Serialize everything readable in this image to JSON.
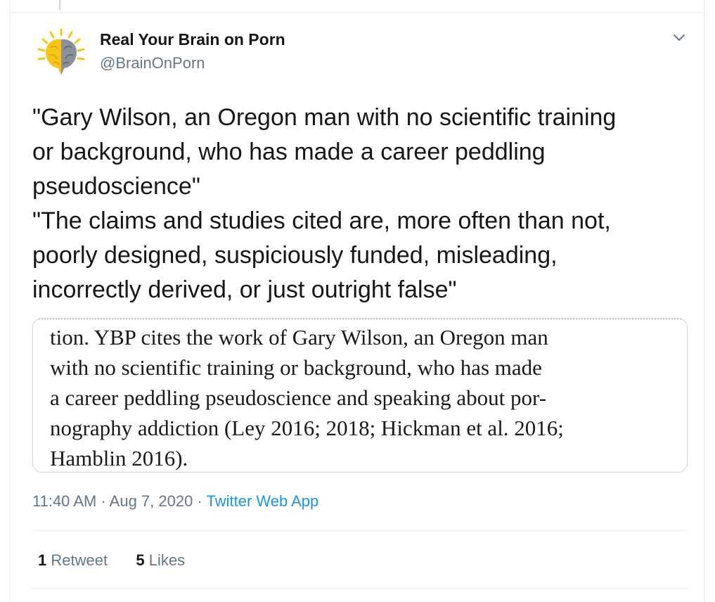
{
  "author": {
    "display_name": "Real Your Brain on Porn",
    "handle": "@BrainOnPorn",
    "avatar_icon": "brain-sun-logo-icon"
  },
  "tweet": {
    "paragraphs": [
      "\"Gary Wilson, an Oregon man with no scientific training\nor background, who has made a career peddling\npseudoscience\"",
      "\"The claims and studies cited are, more often than not,\npoorly designed, suspiciously funded, misleading,\nincorrectly derived, or just outright false\""
    ]
  },
  "media": {
    "lines": [
      "tion. YBP cites the work of Gary Wilson, an Oregon man",
      "with no scientific training or background, who has made",
      "a career peddling pseudoscience and speaking about por-",
      "nography addiction (Ley 2016; 2018; Hickman et al. 2016;",
      "Hamblin 2016)."
    ]
  },
  "meta": {
    "time": "11:40 AM",
    "separator": " · ",
    "date": "Aug 7, 2020",
    "source": "Twitter Web App"
  },
  "stats": {
    "retweets_count": "1",
    "retweets_label": "Retweet",
    "likes_count": "5",
    "likes_label": "Likes"
  },
  "colors": {
    "text": "#14171a",
    "secondary": "#657786",
    "link": "#1b95e0",
    "border": "#e6ecf0",
    "logo_yellow": "#f5c518",
    "logo_gray": "#8a8f99"
  },
  "icons": {
    "menu": "chevron-down-icon"
  }
}
